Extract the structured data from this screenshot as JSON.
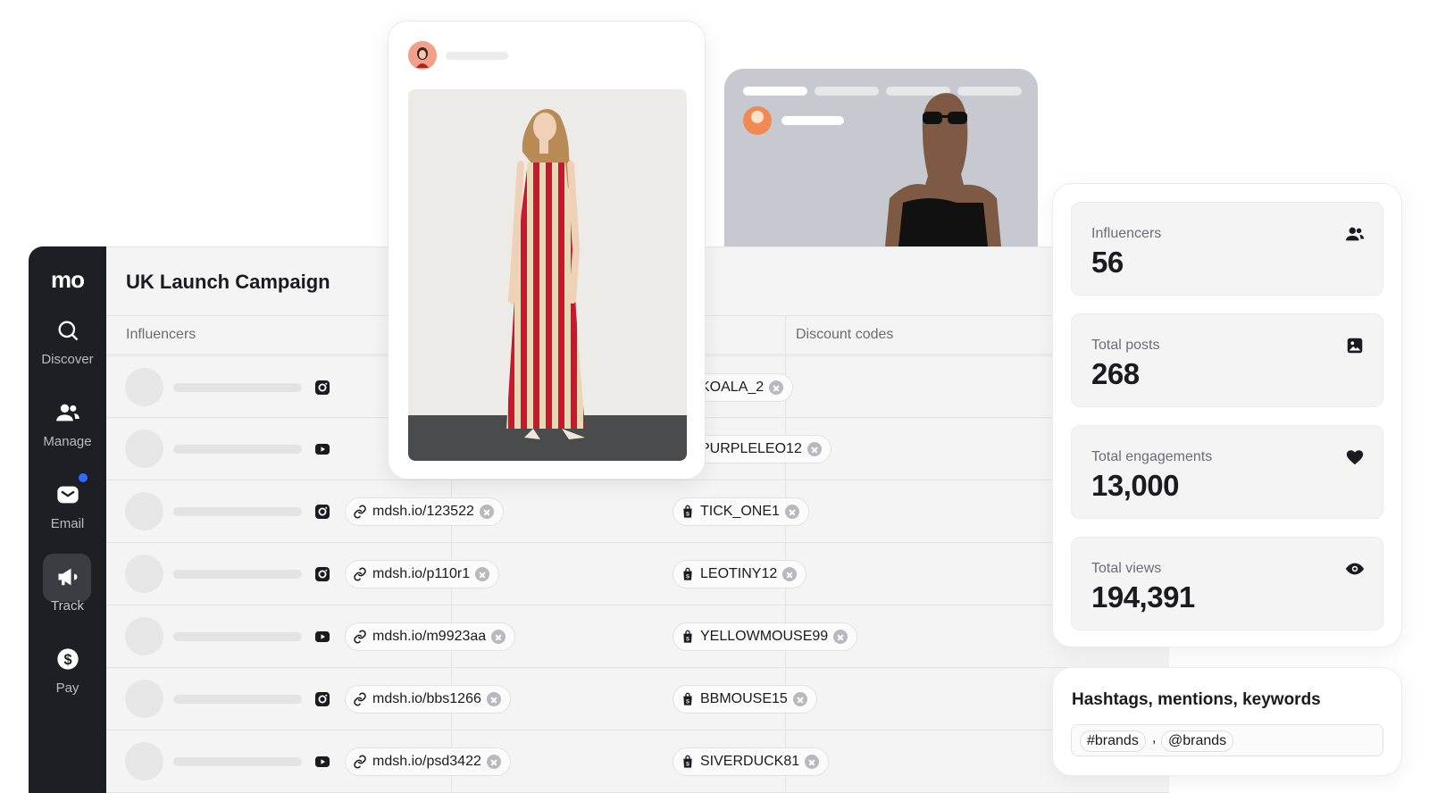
{
  "sidebar": {
    "logo": "mo",
    "items": [
      {
        "label": "Discover",
        "icon": "search-icon"
      },
      {
        "label": "Manage",
        "icon": "users-icon"
      },
      {
        "label": "Email",
        "icon": "mail-icon",
        "notification": true
      },
      {
        "label": "Track",
        "icon": "megaphone-icon",
        "active": true
      },
      {
        "label": "Pay",
        "icon": "dollar-icon"
      }
    ]
  },
  "campaign": {
    "title": "UK Launch Campaign",
    "columns": [
      "Influencers",
      "Discount codes"
    ],
    "rows": [
      {
        "platform": "instagram-icon",
        "link": "",
        "code": "KOALA_2"
      },
      {
        "platform": "youtube-icon",
        "link": "",
        "code": "PURPLELEO12"
      },
      {
        "platform": "instagram-icon",
        "link": "mdsh.io/123522",
        "code": "TICK_ONE1"
      },
      {
        "platform": "instagram-icon",
        "link": "mdsh.io/p110r1",
        "code": "LEOTINY12"
      },
      {
        "platform": "youtube-icon",
        "link": "mdsh.io/m9923aa",
        "code": "YELLOWMOUSE99"
      },
      {
        "platform": "instagram-icon",
        "link": "mdsh.io/bbs1266",
        "code": "BBMOUSE15"
      },
      {
        "platform": "youtube-icon",
        "link": "mdsh.io/psd3422",
        "code": "SIVERDUCK81"
      }
    ]
  },
  "stats": [
    {
      "label": "Influencers",
      "value": "56",
      "icon": "users-icon"
    },
    {
      "label": "Total posts",
      "value": "268",
      "icon": "image-icon"
    },
    {
      "label": "Total engagements",
      "value": "13,000",
      "icon": "heart-icon"
    },
    {
      "label": "Total views",
      "value": "194,391",
      "icon": "eye-icon"
    }
  ],
  "tracking": {
    "heading": "Hashtags, mentions, keywords",
    "tags": [
      "#brands",
      "@brands"
    ],
    "separator": ","
  },
  "colors": {
    "sidebar": "#1d1f24",
    "accent": "#2f6bff",
    "stripe": "#c8182f"
  }
}
